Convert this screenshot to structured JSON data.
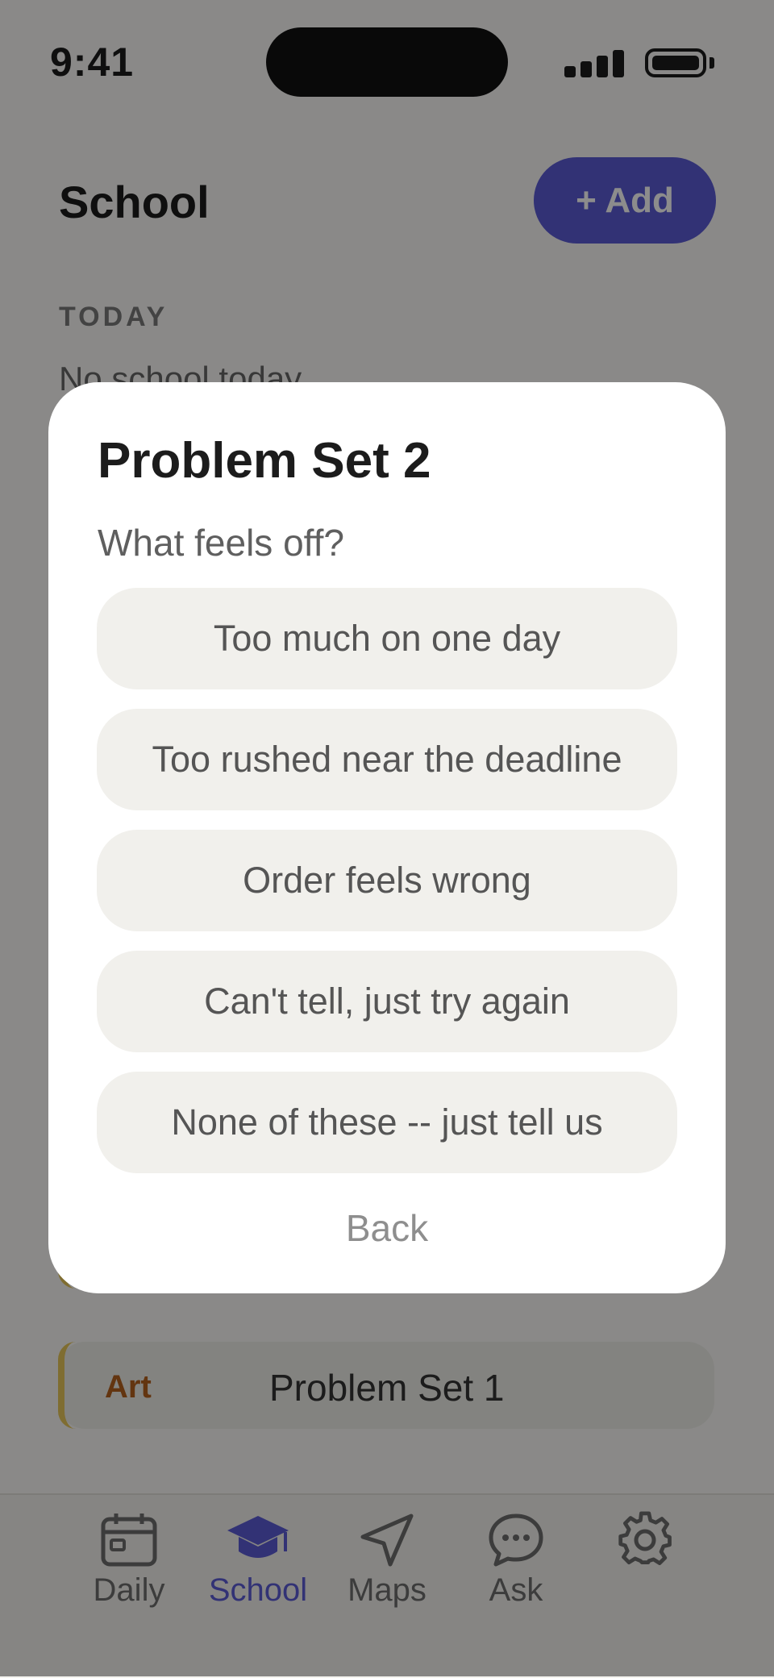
{
  "status_bar": {
    "time": "9:41"
  },
  "header": {
    "title": "School",
    "add_label": "+ Add"
  },
  "today": {
    "section_label": "TODAY",
    "empty_text": "No school today"
  },
  "tasks": [
    {
      "subject": "",
      "name": ""
    },
    {
      "subject": "Art",
      "name": "Problem Set 1"
    }
  ],
  "tab_bar": {
    "tabs": [
      {
        "label": "Daily",
        "icon": "calendar-icon"
      },
      {
        "label": "School",
        "icon": "graduation-cap-icon",
        "active": true
      },
      {
        "label": "Maps",
        "icon": "navigation-arrow-icon"
      },
      {
        "label": "Ask",
        "icon": "chat-bubble-icon"
      },
      {
        "label": "",
        "icon": "gear-icon"
      }
    ]
  },
  "modal": {
    "title": "Problem Set 2",
    "prompt": "What feels off?",
    "options": [
      "Too much on one day",
      "Too rushed near the deadline",
      "Order feels wrong",
      "Can't tell, just try again",
      "None of these -- just tell us"
    ],
    "back_label": "Back"
  },
  "colors": {
    "accent": "#5b5bd6",
    "overlay": "rgba(0,0,0,0.45)",
    "subject_art": "#b5611e",
    "card_stripe": "#e8c75a"
  }
}
